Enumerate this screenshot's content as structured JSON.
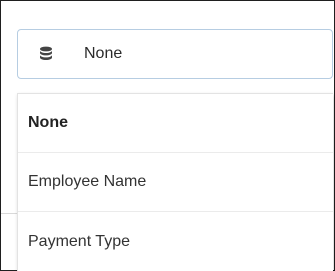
{
  "select": {
    "icon": "database-icon",
    "value": "None"
  },
  "dropdown": {
    "options": [
      {
        "label": "None",
        "selected": true
      },
      {
        "label": "Employee Name",
        "selected": false
      },
      {
        "label": "Payment Type",
        "selected": false
      }
    ]
  }
}
